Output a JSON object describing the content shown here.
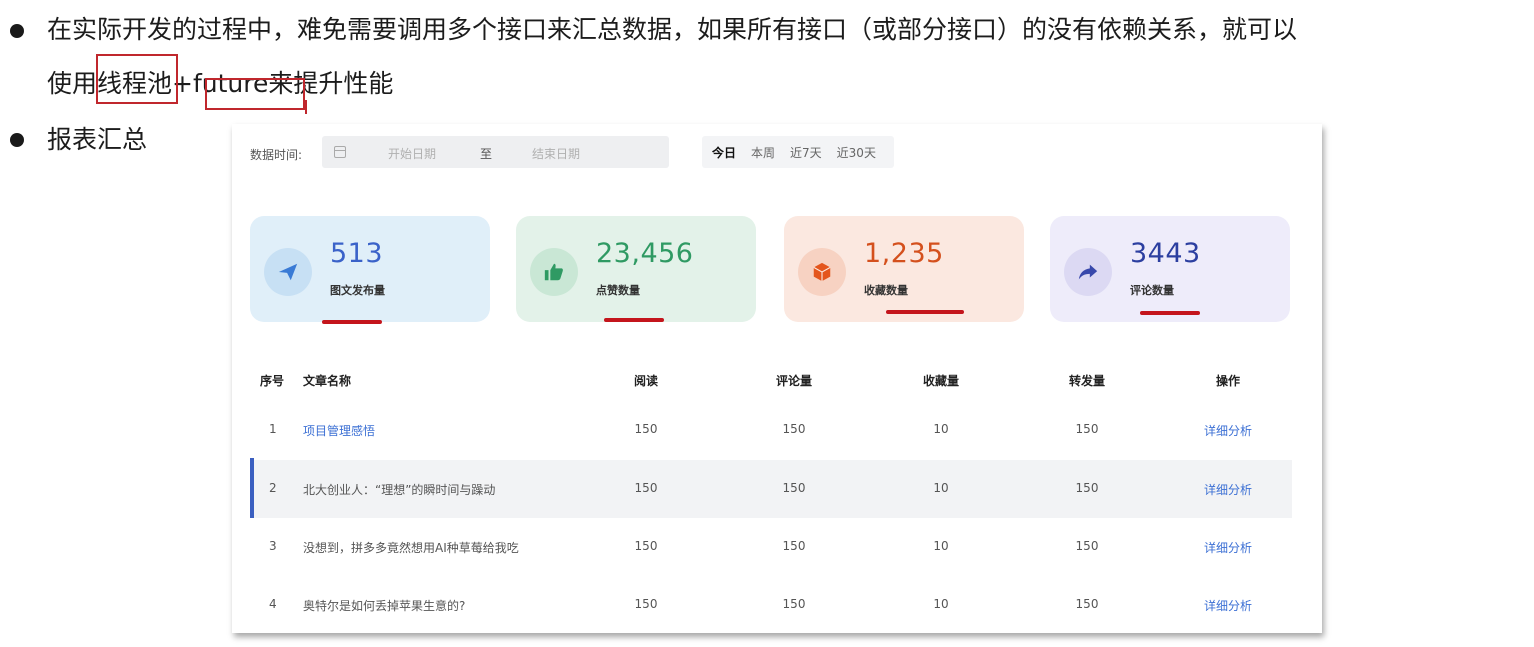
{
  "slide": {
    "bullet1_line1": "在实际开发的过程中，难免需要调用多个接口来汇总数据，如果所有接口（或部分接口）的没有依赖关系，就可以",
    "bullet1_line2": "使用线程池+future来提升性能",
    "bullet2": "报表汇总"
  },
  "dashboard": {
    "filter_label": "数据时间:",
    "date_start_placeholder": "开始日期",
    "date_separator": "至",
    "date_end_placeholder": "结束日期",
    "quick_ranges": [
      "今日",
      "本周",
      "近7天",
      "近30天"
    ],
    "active_range": "今日",
    "cards": [
      {
        "value": "513",
        "label": "图文发布量",
        "icon": "paper-plane-icon",
        "value_color": "#3a62c9",
        "bg": "#e0eff9",
        "icon_bg": "#c7e0f4",
        "icon_color": "#3a7bd5"
      },
      {
        "value": "23,456",
        "label": "点赞数量",
        "icon": "thumbs-up-icon",
        "value_color": "#2f9a63",
        "bg": "#e3f2e9",
        "icon_bg": "#c9e7d5",
        "icon_color": "#2f9a63"
      },
      {
        "value": "1,235",
        "label": "收藏数量",
        "icon": "cube-icon",
        "value_color": "#d4501d",
        "bg": "#fbe8e0",
        "icon_bg": "#f7d2c2",
        "icon_color": "#e4561d"
      },
      {
        "value": "3443",
        "label": "评论数量",
        "icon": "share-arrow-icon",
        "value_color": "#2c3fa0",
        "bg": "#eeecfa",
        "icon_bg": "#dcd9f3",
        "icon_color": "#3949ab"
      }
    ],
    "table": {
      "headers": [
        "序号",
        "文章名称",
        "阅读",
        "评论量",
        "收藏量",
        "转发量",
        "操作"
      ],
      "rows": [
        {
          "no": "1",
          "title": "项目管理感悟",
          "read": "150",
          "comments": "150",
          "favorites": "10",
          "shares": "150",
          "action": "详细分析"
        },
        {
          "no": "2",
          "title": "北大创业人：“理想”的瞬时间与躁动",
          "read": "150",
          "comments": "150",
          "favorites": "10",
          "shares": "150",
          "action": "详细分析"
        },
        {
          "no": "3",
          "title": "没想到，拼多多竟然想用AI种草莓给我吃",
          "read": "150",
          "comments": "150",
          "favorites": "10",
          "shares": "150",
          "action": "详细分析"
        },
        {
          "no": "4",
          "title": "奥特尔是如何丢掉苹果生意的?",
          "read": "150",
          "comments": "150",
          "favorites": "10",
          "shares": "150",
          "action": "详细分析"
        }
      ]
    }
  },
  "colors": {
    "annotation_red": "#c0272d",
    "link_blue": "#3b6fd4"
  }
}
